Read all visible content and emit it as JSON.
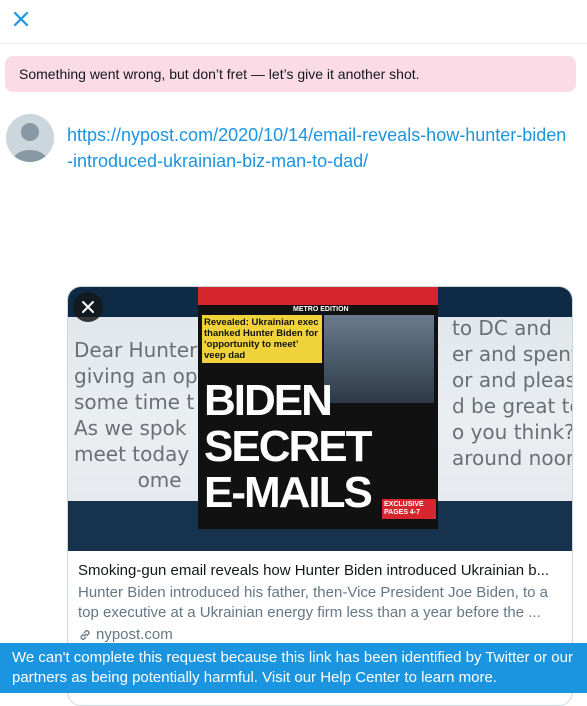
{
  "colors": {
    "accent": "#1b95e0",
    "error_banner_bg": "#fbdce6",
    "alert_bg": "#1b95e0"
  },
  "topbar": {
    "close_icon": "close-icon"
  },
  "error_banner": {
    "text": "Something went wrong, but don’t fret — let’s give it another shot."
  },
  "tweet": {
    "avatar_icon": "default-avatar-icon",
    "link_text": "https://nypost.com/2020/10/14/email-reveals-how-hunter-biden-introduced-ukrainian-biz-man-to-dad/"
  },
  "card": {
    "image": {
      "left_text": "Dear Hunter\ngiving an op\nsome time t\nAs we spok\nmeet today\n          ome",
      "right_text": "to DC and\ner and spent\nor and pleasu\nd be great to\no you think? I\naround noon",
      "newspaper_kicker": "Revealed: Ukrainian exec thanked Hunter Biden for ‘opportunity to meet’ veep dad",
      "newspaper_edition": "METRO EDITION",
      "newspaper_headline_1": "BIDEN",
      "newspaper_headline_2": "SECRET",
      "newspaper_headline_3": "E-MAILS",
      "newspaper_badge": "EXCLUSIVE PAGES 4-7"
    },
    "title": "Smoking-gun email reveals how Hunter Biden introduced Ukrainian b...",
    "description": "Hunter Biden introduced his father, then-Vice President Joe Biden, to a top executive at a Ukrainian energy firm less than a year before the ...",
    "domain": "nypost.com",
    "link_icon": "link-icon",
    "dismiss_icon": "close-icon"
  },
  "bottom_alert": {
    "text": "We can't complete this request because this link has been identified by Twitter or our partners as being potentially harmful. Visit our Help Center to learn more."
  }
}
